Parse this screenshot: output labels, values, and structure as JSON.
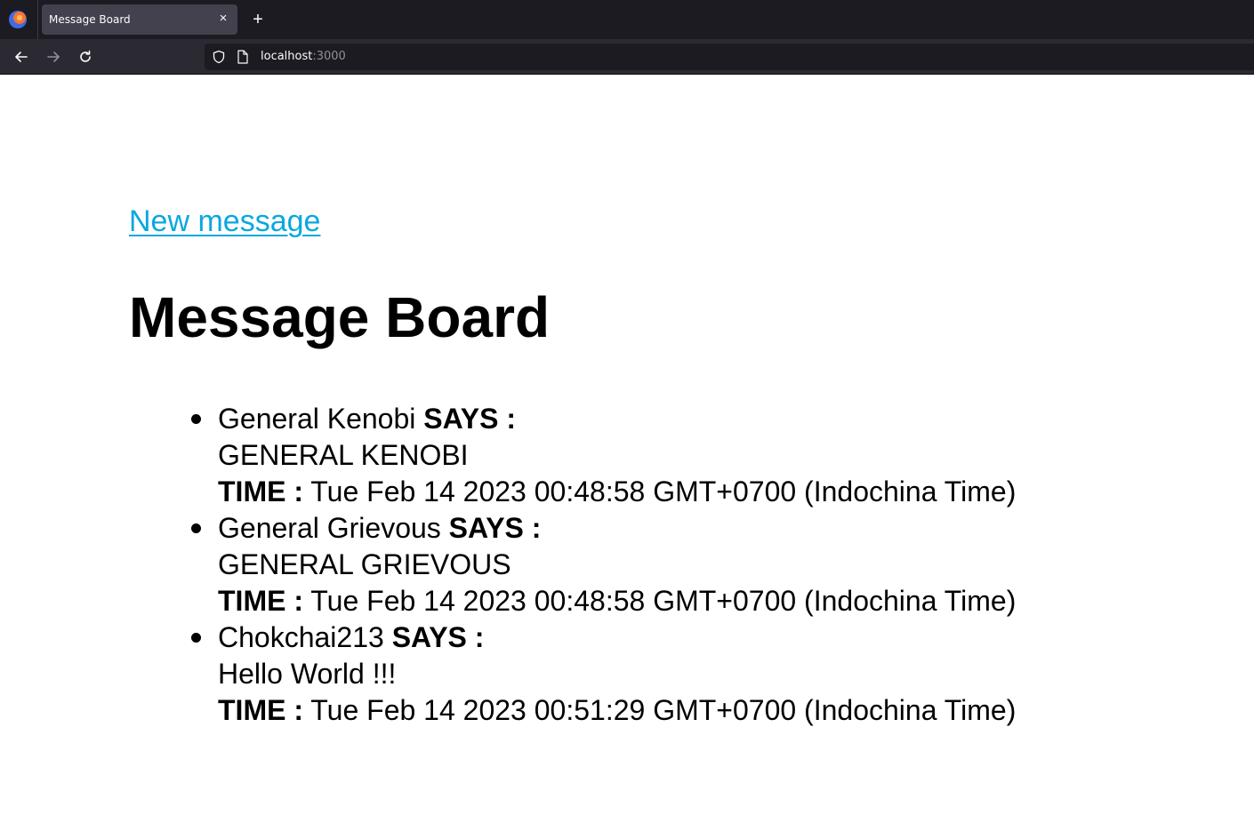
{
  "browser": {
    "tab_title": "Message Board",
    "tab_close": "×",
    "new_tab": "+",
    "url_host": "localhost",
    "url_port": ":3000"
  },
  "page": {
    "new_message_link": "New message",
    "title": "Message Board",
    "says_label": "SAYS :",
    "time_label": "TIME :"
  },
  "messages": [
    {
      "author": "General Kenobi",
      "text": "GENERAL KENOBI",
      "time": "Tue Feb 14 2023 00:48:58 GMT+0700 (Indochina Time)"
    },
    {
      "author": "General Grievous",
      "text": "GENERAL GRIEVOUS",
      "time": "Tue Feb 14 2023 00:48:58 GMT+0700 (Indochina Time)"
    },
    {
      "author": "Chokchai213",
      "text": "Hello World !!!",
      "time": "Tue Feb 14 2023 00:51:29 GMT+0700 (Indochina Time)"
    }
  ],
  "icons": {
    "browser_logo": "firefox-logo-icon",
    "back": "arrow-left-icon",
    "forward": "arrow-right-icon",
    "reload": "reload-icon",
    "tracking": "shield-icon",
    "page": "page-icon"
  },
  "colors": {
    "link": "#0aa7e0",
    "chrome_dark": "#1c1b22",
    "chrome_bar": "#2b2a33"
  }
}
